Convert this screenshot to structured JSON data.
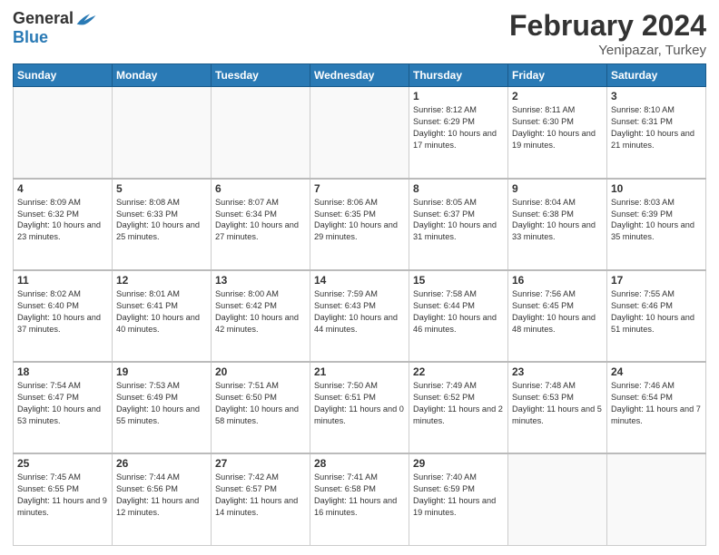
{
  "header": {
    "logo_general": "General",
    "logo_blue": "Blue",
    "title": "February 2024",
    "location": "Yenipazar, Turkey"
  },
  "days_of_week": [
    "Sunday",
    "Monday",
    "Tuesday",
    "Wednesday",
    "Thursday",
    "Friday",
    "Saturday"
  ],
  "weeks": [
    [
      {
        "day": "",
        "info": ""
      },
      {
        "day": "",
        "info": ""
      },
      {
        "day": "",
        "info": ""
      },
      {
        "day": "",
        "info": ""
      },
      {
        "day": "1",
        "info": "Sunrise: 8:12 AM\nSunset: 6:29 PM\nDaylight: 10 hours\nand 17 minutes."
      },
      {
        "day": "2",
        "info": "Sunrise: 8:11 AM\nSunset: 6:30 PM\nDaylight: 10 hours\nand 19 minutes."
      },
      {
        "day": "3",
        "info": "Sunrise: 8:10 AM\nSunset: 6:31 PM\nDaylight: 10 hours\nand 21 minutes."
      }
    ],
    [
      {
        "day": "4",
        "info": "Sunrise: 8:09 AM\nSunset: 6:32 PM\nDaylight: 10 hours\nand 23 minutes."
      },
      {
        "day": "5",
        "info": "Sunrise: 8:08 AM\nSunset: 6:33 PM\nDaylight: 10 hours\nand 25 minutes."
      },
      {
        "day": "6",
        "info": "Sunrise: 8:07 AM\nSunset: 6:34 PM\nDaylight: 10 hours\nand 27 minutes."
      },
      {
        "day": "7",
        "info": "Sunrise: 8:06 AM\nSunset: 6:35 PM\nDaylight: 10 hours\nand 29 minutes."
      },
      {
        "day": "8",
        "info": "Sunrise: 8:05 AM\nSunset: 6:37 PM\nDaylight: 10 hours\nand 31 minutes."
      },
      {
        "day": "9",
        "info": "Sunrise: 8:04 AM\nSunset: 6:38 PM\nDaylight: 10 hours\nand 33 minutes."
      },
      {
        "day": "10",
        "info": "Sunrise: 8:03 AM\nSunset: 6:39 PM\nDaylight: 10 hours\nand 35 minutes."
      }
    ],
    [
      {
        "day": "11",
        "info": "Sunrise: 8:02 AM\nSunset: 6:40 PM\nDaylight: 10 hours\nand 37 minutes."
      },
      {
        "day": "12",
        "info": "Sunrise: 8:01 AM\nSunset: 6:41 PM\nDaylight: 10 hours\nand 40 minutes."
      },
      {
        "day": "13",
        "info": "Sunrise: 8:00 AM\nSunset: 6:42 PM\nDaylight: 10 hours\nand 42 minutes."
      },
      {
        "day": "14",
        "info": "Sunrise: 7:59 AM\nSunset: 6:43 PM\nDaylight: 10 hours\nand 44 minutes."
      },
      {
        "day": "15",
        "info": "Sunrise: 7:58 AM\nSunset: 6:44 PM\nDaylight: 10 hours\nand 46 minutes."
      },
      {
        "day": "16",
        "info": "Sunrise: 7:56 AM\nSunset: 6:45 PM\nDaylight: 10 hours\nand 48 minutes."
      },
      {
        "day": "17",
        "info": "Sunrise: 7:55 AM\nSunset: 6:46 PM\nDaylight: 10 hours\nand 51 minutes."
      }
    ],
    [
      {
        "day": "18",
        "info": "Sunrise: 7:54 AM\nSunset: 6:47 PM\nDaylight: 10 hours\nand 53 minutes."
      },
      {
        "day": "19",
        "info": "Sunrise: 7:53 AM\nSunset: 6:49 PM\nDaylight: 10 hours\nand 55 minutes."
      },
      {
        "day": "20",
        "info": "Sunrise: 7:51 AM\nSunset: 6:50 PM\nDaylight: 10 hours\nand 58 minutes."
      },
      {
        "day": "21",
        "info": "Sunrise: 7:50 AM\nSunset: 6:51 PM\nDaylight: 11 hours\nand 0 minutes."
      },
      {
        "day": "22",
        "info": "Sunrise: 7:49 AM\nSunset: 6:52 PM\nDaylight: 11 hours\nand 2 minutes."
      },
      {
        "day": "23",
        "info": "Sunrise: 7:48 AM\nSunset: 6:53 PM\nDaylight: 11 hours\nand 5 minutes."
      },
      {
        "day": "24",
        "info": "Sunrise: 7:46 AM\nSunset: 6:54 PM\nDaylight: 11 hours\nand 7 minutes."
      }
    ],
    [
      {
        "day": "25",
        "info": "Sunrise: 7:45 AM\nSunset: 6:55 PM\nDaylight: 11 hours\nand 9 minutes."
      },
      {
        "day": "26",
        "info": "Sunrise: 7:44 AM\nSunset: 6:56 PM\nDaylight: 11 hours\nand 12 minutes."
      },
      {
        "day": "27",
        "info": "Sunrise: 7:42 AM\nSunset: 6:57 PM\nDaylight: 11 hours\nand 14 minutes."
      },
      {
        "day": "28",
        "info": "Sunrise: 7:41 AM\nSunset: 6:58 PM\nDaylight: 11 hours\nand 16 minutes."
      },
      {
        "day": "29",
        "info": "Sunrise: 7:40 AM\nSunset: 6:59 PM\nDaylight: 11 hours\nand 19 minutes."
      },
      {
        "day": "",
        "info": ""
      },
      {
        "day": "",
        "info": ""
      }
    ]
  ]
}
